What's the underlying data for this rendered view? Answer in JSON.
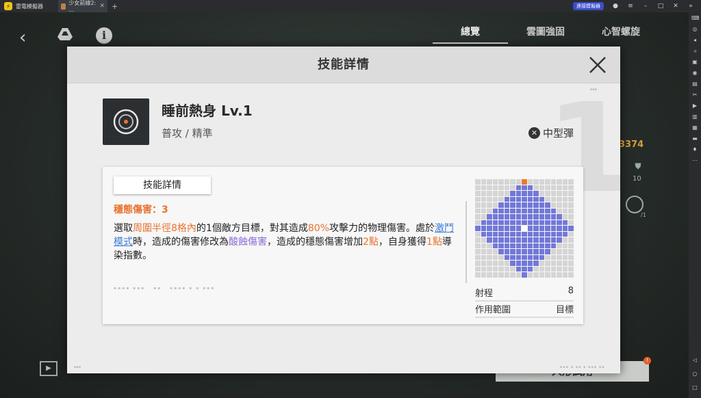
{
  "emulator": {
    "app_name": "雷電模擬器",
    "tab_title": "少女前線2: ...",
    "tab_close": "✕",
    "tab_add": "+",
    "connect_label": "連接模擬器",
    "window_icons": [
      "user-icon",
      "menu-icon",
      "minimize-icon",
      "restore-icon",
      "close-icon",
      "expand-icon"
    ],
    "toolbar_icons": [
      "keyboard-icon",
      "gamepad-icon",
      "volume-up-icon",
      "volume-down-icon",
      "screenshot-icon",
      "record-icon",
      "apk-icon",
      "cut-icon",
      "video-icon",
      "shake-icon",
      "sync-icon",
      "folder-icon",
      "location-icon",
      "more-icon"
    ],
    "nav_icons": [
      "back-nav-icon",
      "home-nav-icon",
      "recent-nav-icon"
    ]
  },
  "background": {
    "tabs": [
      {
        "label": "總覽",
        "active": true
      },
      {
        "label": "雲圖強固",
        "active": false
      },
      {
        "label": "心智螺旋",
        "active": false
      }
    ],
    "score": "3374",
    "shield_value": "10",
    "slash_value": "/1",
    "trial_button": "人形試用",
    "trial_badge": "!"
  },
  "modal": {
    "title": "技能詳情",
    "watermark": "1",
    "skill": {
      "name": "睡前熱身 Lv.1",
      "type": "普攻 / 精準",
      "ammo_type": "中型彈"
    },
    "detail": {
      "tag": "技能詳情",
      "stagger_label": "穩態傷害：3",
      "desc": {
        "s1": "選取",
        "s2": "周圍半徑8格內",
        "s3": "的1個敵方目標，對其造成",
        "s4": "80%",
        "s5": "攻擊力的物理傷害。處於",
        "s6": "激鬥模式",
        "s7": "時，造成的傷害修改為",
        "s8": "酸蝕傷害",
        "s9": "，造成的穩態傷害增加",
        "s10": "2點",
        "s11": "，自身獲得",
        "s12": "1點",
        "s13": "導染指數。"
      }
    },
    "stats": {
      "range_label": "射程",
      "range_value": "8",
      "area_label": "作用範圍",
      "area_value": "目標"
    }
  },
  "colors": {
    "accent_orange": "#e8732f",
    "link_blue": "#3b7bd6",
    "acid_purple": "#8a6ad6",
    "grid_active": "#7278d8"
  }
}
